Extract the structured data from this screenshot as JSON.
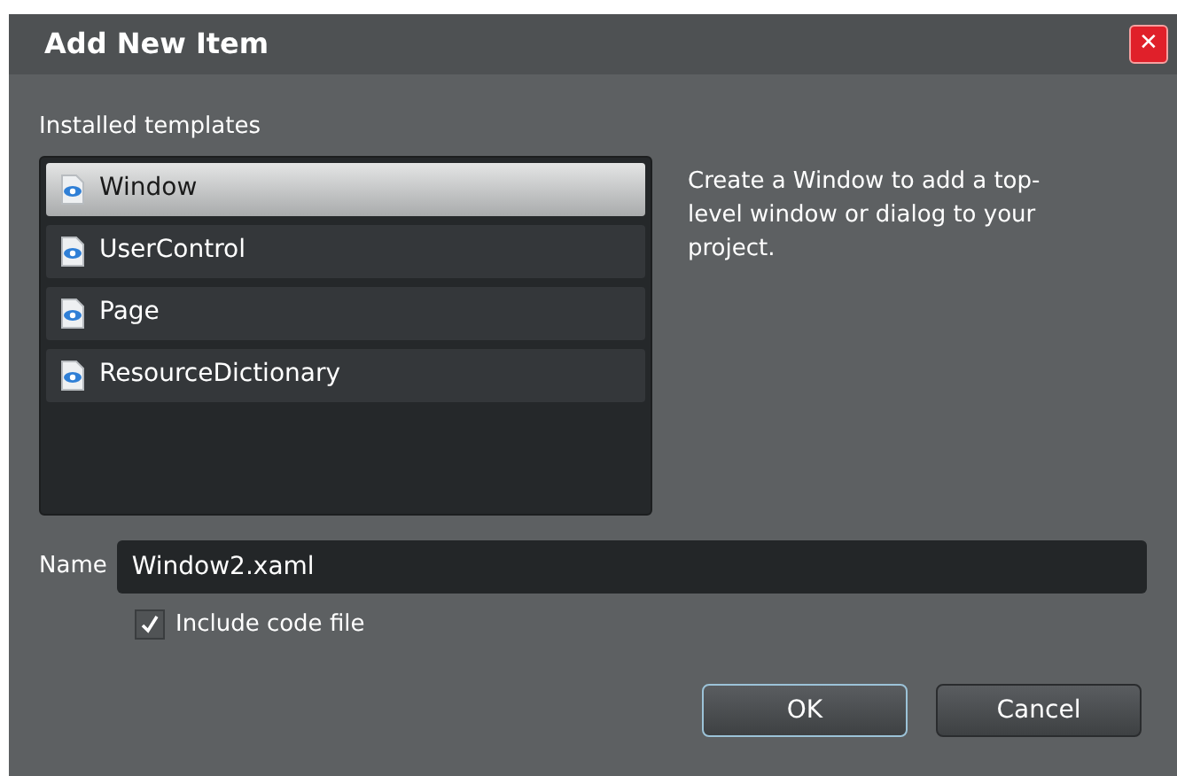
{
  "window": {
    "title": "Add New Item",
    "close": "✕"
  },
  "templates": {
    "label": "Installed templates",
    "items": [
      {
        "label": "Window",
        "selected": true
      },
      {
        "label": "UserControl",
        "selected": false
      },
      {
        "label": "Page",
        "selected": false
      },
      {
        "label": "ResourceDictionary",
        "selected": false
      }
    ]
  },
  "description": "Create a Window to add a top-level window or dialog to your project.",
  "name": {
    "label": "Name",
    "value": "Window2.xaml"
  },
  "include_code": {
    "label": "Include code file",
    "checked": true
  },
  "buttons": [
    {
      "label": "OK",
      "default": true
    },
    {
      "label": "Cancel",
      "default": false
    }
  ]
}
